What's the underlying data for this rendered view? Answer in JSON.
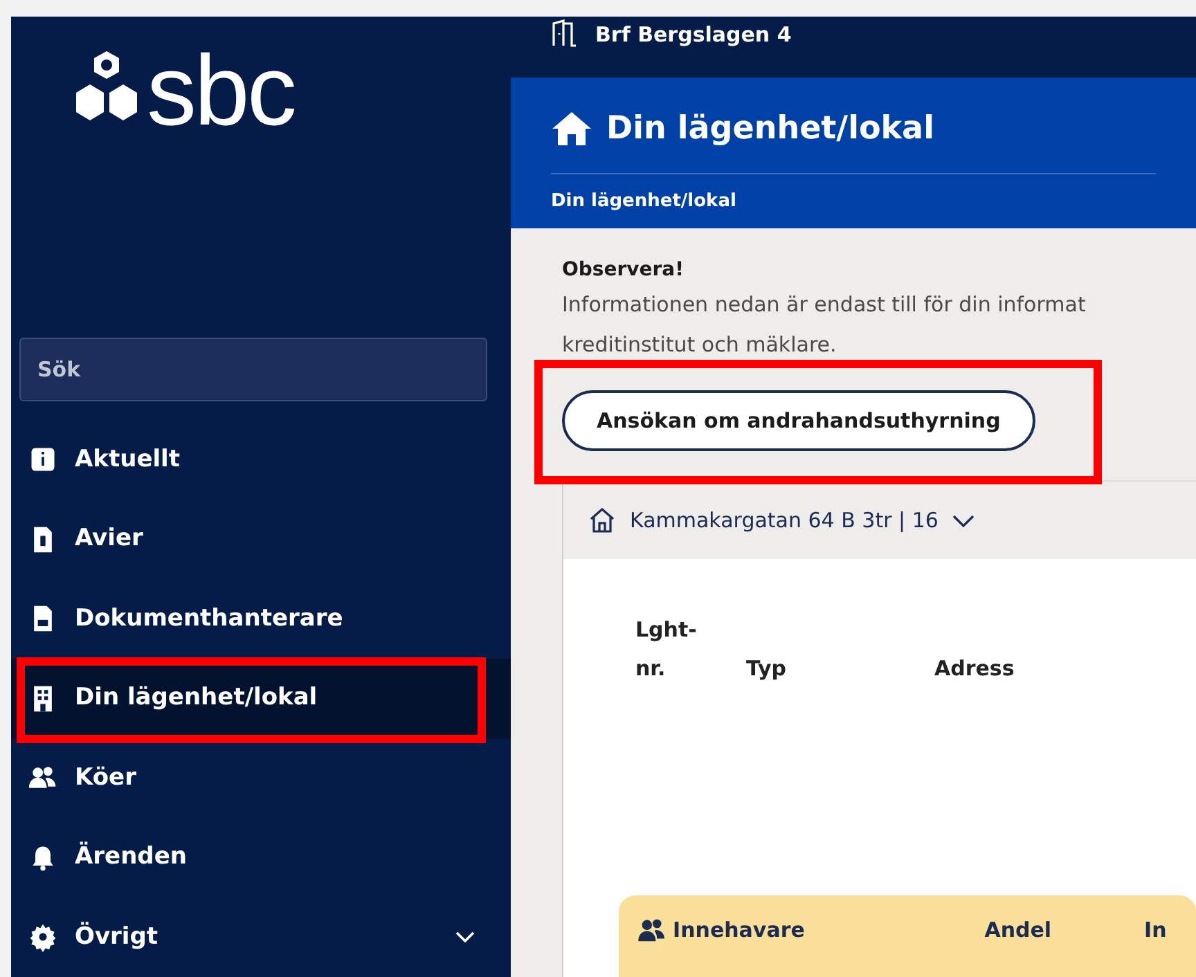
{
  "logo": {
    "text": "sbc"
  },
  "search": {
    "placeholder": "Sök"
  },
  "sidebar": {
    "items": [
      {
        "label": "Aktuellt",
        "selected": false,
        "highlighted": false
      },
      {
        "label": "Avier",
        "selected": false,
        "highlighted": false
      },
      {
        "label": "Dokumenthanterare",
        "selected": false,
        "highlighted": false
      },
      {
        "label": "Din lägenhet/lokal",
        "selected": true,
        "highlighted": true
      },
      {
        "label": "Köer",
        "selected": false,
        "highlighted": false
      },
      {
        "label": "Ärenden",
        "selected": false,
        "highlighted": false
      },
      {
        "label": "Övrigt",
        "selected": false,
        "highlighted": false,
        "expandable": true
      }
    ]
  },
  "topbar": {
    "association": "Brf Bergslagen 4"
  },
  "header": {
    "title": "Din lägenhet/lokal",
    "breadcrumb": "Din lägenhet/lokal"
  },
  "notice": {
    "title": "Observera!",
    "lines": [
      "Informationen nedan är endast till för din informat",
      "kreditinstitut och mäklare."
    ]
  },
  "action_button": {
    "label": "Ansökan om andrahandsuthyrning",
    "highlighted": true
  },
  "property": {
    "address": "Kammakargatan 64 B 3tr | 16",
    "columns": [
      {
        "lines": [
          "Lght-",
          "nr."
        ]
      },
      {
        "lines": [
          "Typ"
        ]
      },
      {
        "lines": [
          "Adress"
        ]
      }
    ],
    "owners_panel": {
      "columns": [
        "Innehavare",
        "Andel",
        "In"
      ]
    }
  }
}
